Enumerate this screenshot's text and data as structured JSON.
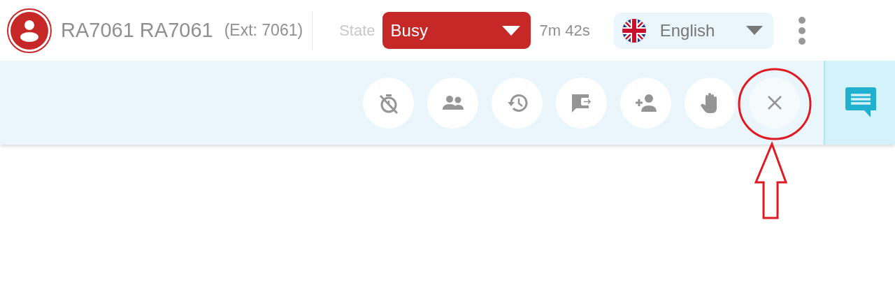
{
  "agent": {
    "name": "RA7061 RA7061",
    "extension": "(Ext: 7061)"
  },
  "state": {
    "label": "State",
    "value": "Busy",
    "timer": "7m 42s"
  },
  "language": {
    "value": "English"
  }
}
